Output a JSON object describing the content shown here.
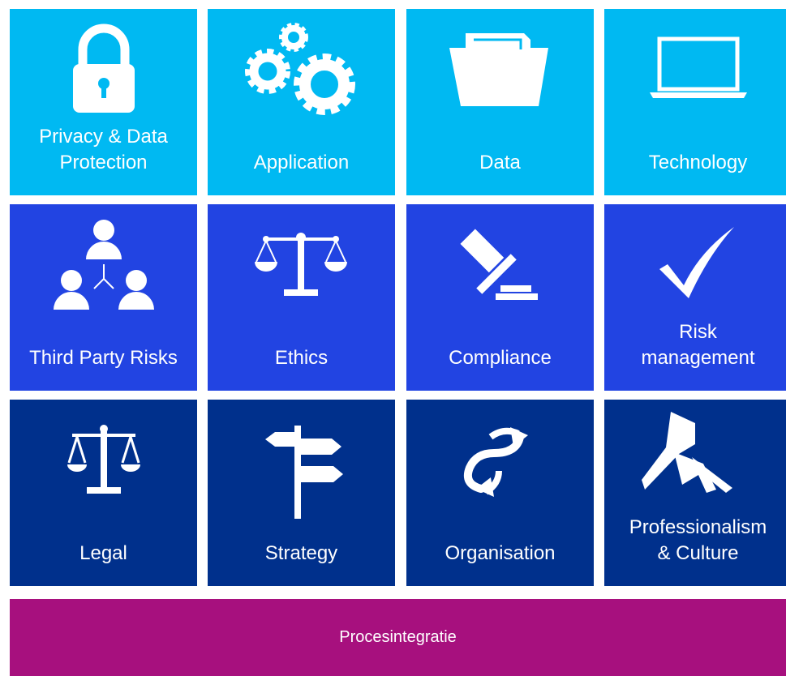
{
  "colors": {
    "row1": "#00B9F2",
    "row2": "#2244E2",
    "row3": "#00308C",
    "bar": "#A7107E",
    "text": "#FFFFFF"
  },
  "tiles": [
    {
      "label": "Privacy & Data\nProtection",
      "icon": "padlock-icon"
    },
    {
      "label": "Application",
      "icon": "gears-icon"
    },
    {
      "label": "Data",
      "icon": "folder-icon"
    },
    {
      "label": "Technology",
      "icon": "laptop-icon"
    },
    {
      "label": "Third Party Risks",
      "icon": "people-network-icon"
    },
    {
      "label": "Ethics",
      "icon": "balance-scale-icon"
    },
    {
      "label": "Compliance",
      "icon": "gavel-icon"
    },
    {
      "label": "Risk\nmanagement",
      "icon": "checkmark-icon"
    },
    {
      "label": "Legal",
      "icon": "legal-scale-icon"
    },
    {
      "label": "Strategy",
      "icon": "signpost-icon"
    },
    {
      "label": "Organisation",
      "icon": "cycle-arrows-icon"
    },
    {
      "label": "Professionalism\n& Culture",
      "icon": "handshake-icon"
    }
  ],
  "bar": {
    "label": "Procesintegratie"
  }
}
